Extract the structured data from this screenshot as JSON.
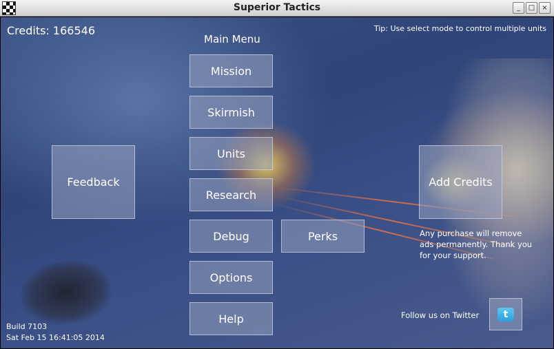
{
  "window": {
    "title": "Superior Tactics",
    "controls": {
      "minimize": "_",
      "maximize": "□",
      "close": "×"
    }
  },
  "hud": {
    "credits": "Credits: 166546",
    "tip": "Tip: Use select mode to control multiple units",
    "menu_title": "Main Menu"
  },
  "menu": {
    "mission": "Mission",
    "skirmish": "Skirmish",
    "units": "Units",
    "research": "Research",
    "debug": "Debug",
    "perks": "Perks",
    "options": "Options",
    "help": "Help"
  },
  "side": {
    "feedback": "Feedback",
    "add_credits": "Add Credits",
    "purchase_note": "Any purchase will remove ads permanently. Thank you for your support."
  },
  "social": {
    "follow": "Follow us on Twitter",
    "twitter_glyph": "t"
  },
  "build": {
    "number": "Build 7103",
    "date": "Sat Feb 15 16:41:05 2014"
  },
  "icons": {
    "app": "checkered-flag-icon",
    "twitter": "twitter-bird-icon"
  },
  "colors": {
    "button_bg": "#96a0be",
    "twitter_blue": "#2a9fd8"
  }
}
